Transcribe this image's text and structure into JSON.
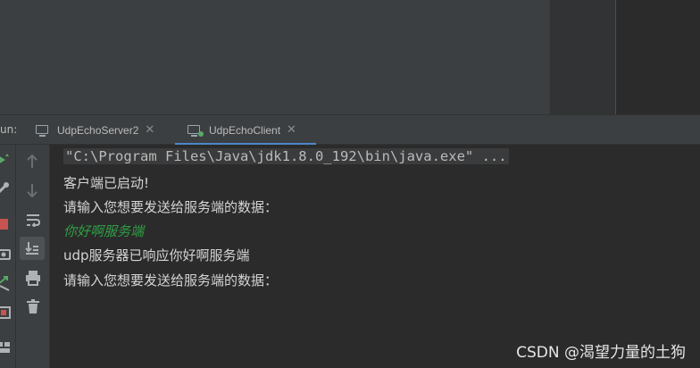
{
  "run_panel": {
    "label": "un:",
    "tabs": [
      {
        "label": "UdpEchoServer2",
        "close": "✕",
        "icon": "app-window-icon"
      },
      {
        "label": "UdpEchoClient",
        "close": "✕",
        "icon": "app-window-running-icon"
      }
    ],
    "active_tab": "UdpEchoClient"
  },
  "console": {
    "command_line": "\"C:\\Program Files\\Java\\jdk1.8.0_192\\bin\\java.exe\" ...",
    "lines": [
      "客户端已启动!",
      "请输入您想要发送给服务端的数据：",
      "你好啊服务端",
      "udp服务器已响应你好啊服务端",
      "请输入您想要发送给服务端的数据："
    ]
  },
  "watermark": "CSDN @渴望力量的土狗",
  "colors": {
    "accent": "#4a88c7",
    "user_input": "#2ea043",
    "background": "#2b2b2b",
    "panel": "#3c3f41"
  }
}
